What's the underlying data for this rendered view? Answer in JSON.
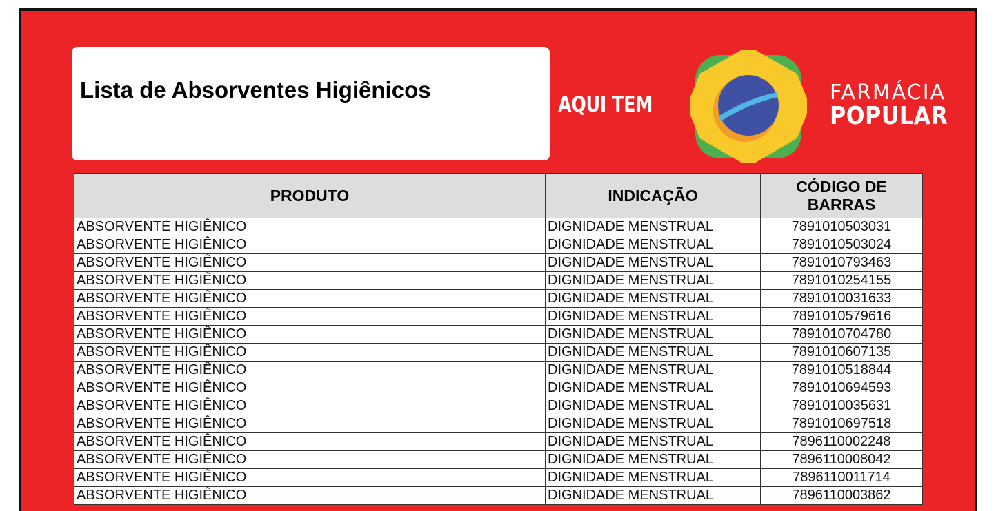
{
  "header": {
    "title": "Lista de Absorventes Higiênicos",
    "aqui_tem": "AQUI TEM",
    "brand_top": "FARMÁCIA",
    "brand_bottom": "POPULAR"
  },
  "colors": {
    "page_red": "#ec2327",
    "logo_green": "#4caf50",
    "logo_yellow": "#f9c82b",
    "logo_orange": "#f39c2a",
    "logo_blue": "#3f51a3",
    "logo_stripe": "#4fb6e6"
  },
  "table": {
    "headers": [
      "PRODUTO",
      "INDICAÇÃO",
      "CÓDIGO DE BARRAS"
    ],
    "rows": [
      {
        "produto": "ABSORVENTE HIGIÊNICO",
        "indicacao": "DIGNIDADE MENSTRUAL",
        "codigo": "7891010503031"
      },
      {
        "produto": "ABSORVENTE HIGIÊNICO",
        "indicacao": "DIGNIDADE MENSTRUAL",
        "codigo": "7891010503024"
      },
      {
        "produto": "ABSORVENTE HIGIÊNICO",
        "indicacao": "DIGNIDADE MENSTRUAL",
        "codigo": "7891010793463"
      },
      {
        "produto": "ABSORVENTE HIGIÊNICO",
        "indicacao": "DIGNIDADE MENSTRUAL",
        "codigo": "7891010254155"
      },
      {
        "produto": "ABSORVENTE HIGIÊNICO",
        "indicacao": "DIGNIDADE MENSTRUAL",
        "codigo": "7891010031633"
      },
      {
        "produto": "ABSORVENTE HIGIÊNICO",
        "indicacao": "DIGNIDADE MENSTRUAL",
        "codigo": "7891010579616"
      },
      {
        "produto": "ABSORVENTE HIGIÊNICO",
        "indicacao": "DIGNIDADE MENSTRUAL",
        "codigo": "7891010704780"
      },
      {
        "produto": "ABSORVENTE HIGIÊNICO",
        "indicacao": "DIGNIDADE MENSTRUAL",
        "codigo": "7891010607135"
      },
      {
        "produto": "ABSORVENTE HIGIÊNICO",
        "indicacao": "DIGNIDADE MENSTRUAL",
        "codigo": "7891010518844"
      },
      {
        "produto": "ABSORVENTE HIGIÊNICO",
        "indicacao": "DIGNIDADE MENSTRUAL",
        "codigo": "7891010694593"
      },
      {
        "produto": "ABSORVENTE HIGIÊNICO",
        "indicacao": "DIGNIDADE MENSTRUAL",
        "codigo": "7891010035631"
      },
      {
        "produto": "ABSORVENTE HIGIÊNICO",
        "indicacao": "DIGNIDADE MENSTRUAL",
        "codigo": "7891010697518"
      },
      {
        "produto": "ABSORVENTE HIGIÊNICO",
        "indicacao": "DIGNIDADE MENSTRUAL",
        "codigo": "7896110002248"
      },
      {
        "produto": "ABSORVENTE HIGIÊNICO",
        "indicacao": "DIGNIDADE MENSTRUAL",
        "codigo": "7896110008042"
      },
      {
        "produto": "ABSORVENTE HIGIÊNICO",
        "indicacao": "DIGNIDADE MENSTRUAL",
        "codigo": "7896110011714"
      },
      {
        "produto": "ABSORVENTE HIGIÊNICO",
        "indicacao": "DIGNIDADE MENSTRUAL",
        "codigo": "7896110003862"
      }
    ]
  }
}
